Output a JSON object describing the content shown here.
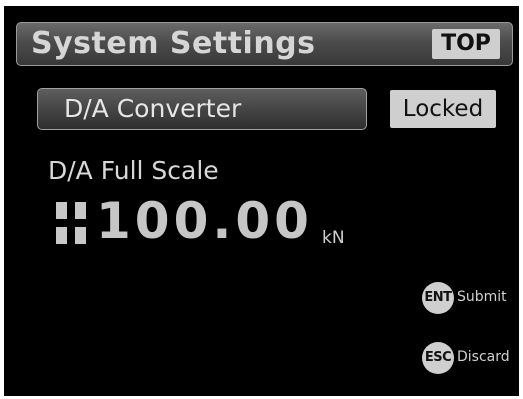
{
  "header": {
    "title": "System Settings",
    "top_label": "TOP"
  },
  "selector": {
    "label": "D/A Converter",
    "lock_status": "Locked"
  },
  "parameter": {
    "label": "D/A Full Scale",
    "sign": "+",
    "value": "100.00",
    "unit": "kN"
  },
  "soft_keys": {
    "enter": {
      "key": "ENT",
      "label": "Submit"
    },
    "escape": {
      "key": "ESC",
      "label": "Discard"
    }
  },
  "colors": {
    "background": "#000000",
    "button_light": "#cfcfcf",
    "text_light": "#d8d8d8"
  }
}
